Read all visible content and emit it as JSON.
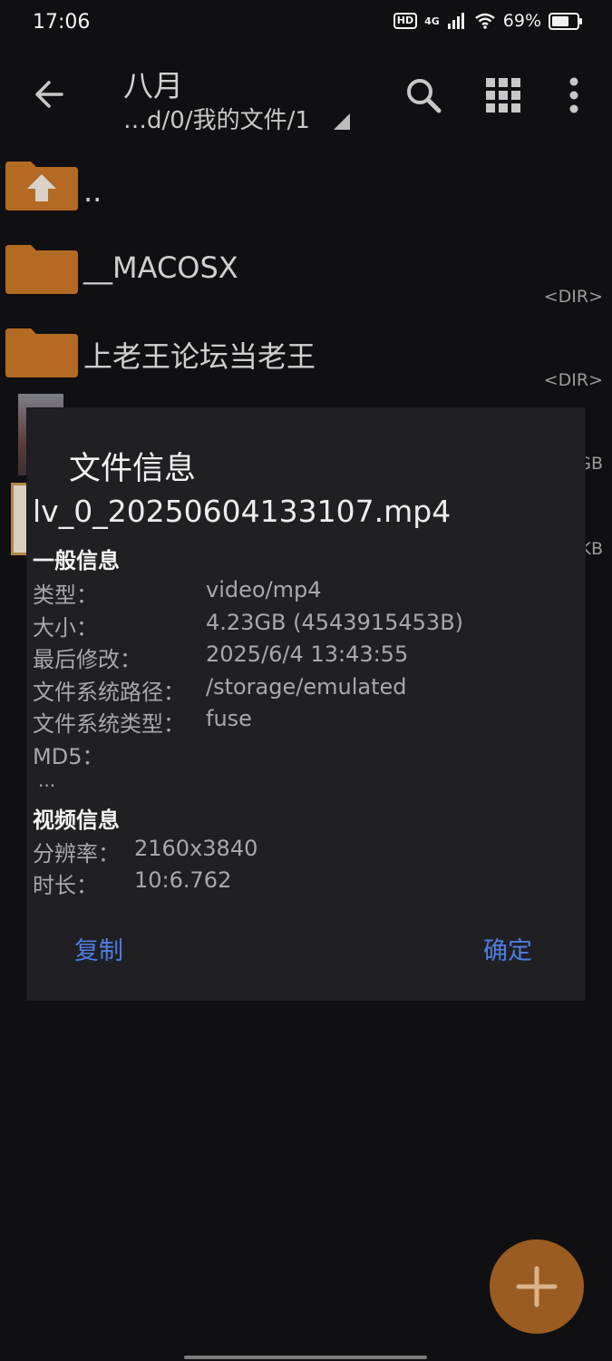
{
  "status_bar": {
    "time": "17:06",
    "hd_badge": "HD",
    "network": "4G",
    "battery": "69%"
  },
  "app_bar": {
    "title": "八月",
    "path": "…d/0/我的文件/1",
    "icons": [
      "back-arrow-icon",
      "search-icon",
      "grid-view-icon",
      "more-vert-icon"
    ]
  },
  "file_list": {
    "items": [
      {
        "name": "..",
        "type": "",
        "icon": "folder-up-icon"
      },
      {
        "name": "__MACOSX",
        "type": "<DIR>",
        "icon": "folder-icon"
      },
      {
        "name": "上老王论坛当老王",
        "type": "<DIR>",
        "icon": "folder-icon"
      }
    ],
    "partial_sizes": [
      "GB",
      "KB"
    ]
  },
  "dialog": {
    "title": "文件信息",
    "filename": "lv_0_20250604133107.mp4",
    "general_section": "一般信息",
    "general": [
      {
        "label": "类型：",
        "value": "video/mp4"
      },
      {
        "label": "大小：",
        "value": "4.23GB (4543915453B)"
      },
      {
        "label": "最后修改：",
        "value": "2025/6/4 13:43:55"
      },
      {
        "label": "文件系统路径：",
        "value": "/storage/emulated"
      },
      {
        "label": "文件系统类型：",
        "value": "fuse"
      },
      {
        "label": "MD5：",
        "value": ""
      }
    ],
    "md5_value": "...",
    "video_section": "视频信息",
    "video": [
      {
        "label": "分辨率：",
        "value": "2160x3840"
      },
      {
        "label": "时长：",
        "value": "10:6.762"
      }
    ],
    "copy_button": "复制",
    "ok_button": "确定"
  },
  "fab": {
    "icon": "plus-icon"
  },
  "colors": {
    "background": "#101012",
    "dialog": "#202024",
    "accent": "#4f7de0",
    "folder": "#b36a22",
    "fab": "#9a5c20"
  }
}
